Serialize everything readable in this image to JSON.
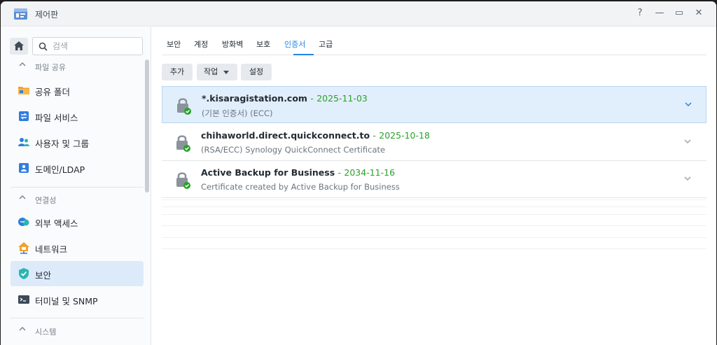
{
  "window": {
    "title": "제어판",
    "controls": {
      "help": "?",
      "minimize": "—",
      "maximize": "▭",
      "close": "✕"
    }
  },
  "sidebar": {
    "search_placeholder": "검색",
    "groups": [
      {
        "label": "파일 공유",
        "items": [
          {
            "label": "공유 폴더",
            "icon": "folder-icon"
          },
          {
            "label": "파일 서비스",
            "icon": "file-services-icon"
          },
          {
            "label": "사용자 및 그룹",
            "icon": "users-groups-icon"
          },
          {
            "label": "도메인/LDAP",
            "icon": "domain-ldap-icon"
          }
        ]
      },
      {
        "label": "연결성",
        "items": [
          {
            "label": "외부 액세스",
            "icon": "external-access-icon"
          },
          {
            "label": "네트워크",
            "icon": "network-icon"
          },
          {
            "label": "보안",
            "icon": "security-shield-icon",
            "active": true
          },
          {
            "label": "터미널 및 SNMP",
            "icon": "terminal-icon"
          }
        ]
      },
      {
        "label": "시스템",
        "items": []
      }
    ]
  },
  "tabs": [
    {
      "label": "보안"
    },
    {
      "label": "계정"
    },
    {
      "label": "방화벽"
    },
    {
      "label": "보호"
    },
    {
      "label": "인증서",
      "active": true
    },
    {
      "label": "고급"
    }
  ],
  "toolbar": {
    "add_label": "추가",
    "action_label": "작업",
    "settings_label": "설정"
  },
  "certificates": [
    {
      "name": "*.kisaragistation.com",
      "separator": "-",
      "date": "2025-11-03",
      "description": "(기본 인증서) (ECC)",
      "selected": true
    },
    {
      "name": "chihaworld.direct.quickconnect.to",
      "separator": "-",
      "date": "2025-10-18",
      "description": "(RSA/ECC) Synology QuickConnect Certificate",
      "selected": false
    },
    {
      "name": "Active Backup for Business",
      "separator": "-",
      "date": "2034-11-16",
      "description": "Certificate created by Active Backup for Business",
      "selected": false
    }
  ],
  "colors": {
    "accent": "#2383e2",
    "valid_green": "#2aa12a",
    "selected_row": "#e1eefb",
    "active_nav": "#dceafa"
  }
}
